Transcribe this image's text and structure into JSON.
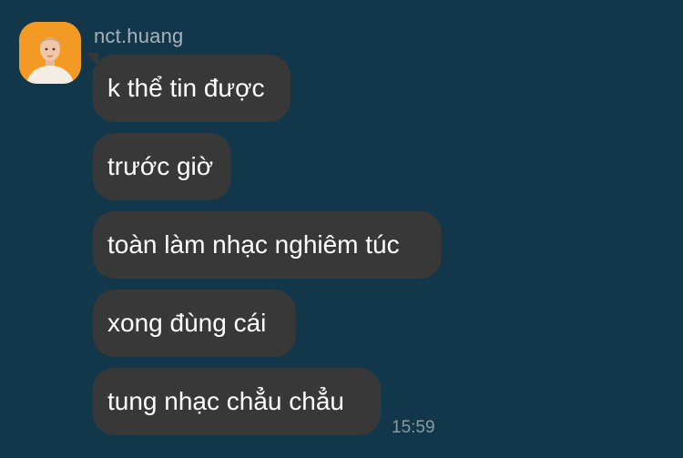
{
  "chat": {
    "sender_name": "nct.huang",
    "avatar_icon": "profile-photo-avatar",
    "messages": [
      {
        "text": "k thể tin được"
      },
      {
        "text": "trước giờ"
      },
      {
        "text": "toàn làm nhạc nghiêm túc"
      },
      {
        "text": "xong đùng cái"
      },
      {
        "text": "tung nhạc chẳu chẳu"
      }
    ],
    "timestamp": "15:59"
  },
  "colors": {
    "background": "#12374a",
    "bubble": "#383838",
    "message_text": "#ffffff",
    "sender_text": "#a5b2ba",
    "timestamp_text": "#8a9aa3",
    "avatar_background": "#f39a24"
  }
}
